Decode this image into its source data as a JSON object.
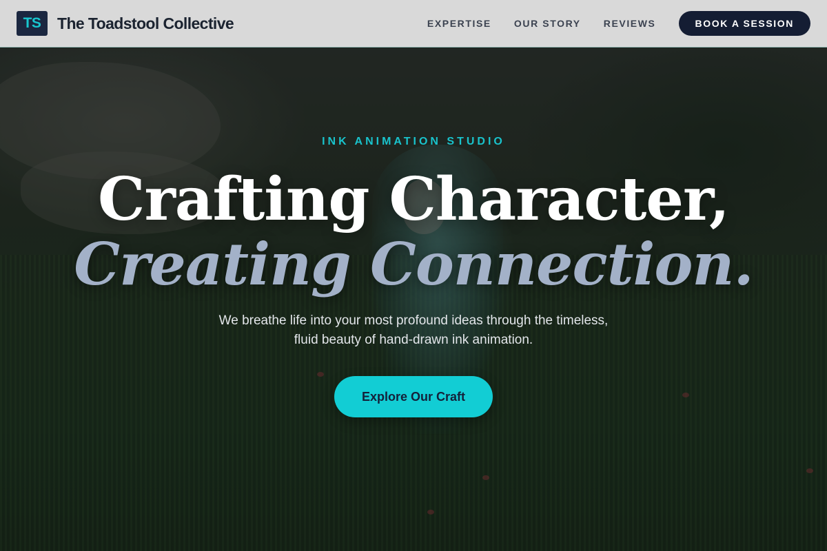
{
  "header": {
    "logo_initials": "TS",
    "brand_name": "The Toadstool Collective",
    "nav": [
      {
        "label": "EXPERTISE"
      },
      {
        "label": "OUR STORY"
      },
      {
        "label": "REVIEWS"
      }
    ],
    "cta_label": "BOOK A SESSION"
  },
  "hero": {
    "eyebrow": "INK ANIMATION STUDIO",
    "headline_line1": "Crafting Character,",
    "headline_line2": "Creating Connection.",
    "subtext_line1": "We breathe life into your most profound ideas through the timeless,",
    "subtext_line2": "fluid beauty of hand-drawn ink animation.",
    "cta_label": "Explore Our Craft"
  },
  "colors": {
    "accent": "#12cdd4",
    "navy": "#141d33",
    "header_bg": "#d9d9d9",
    "headline_secondary": "#a3b1c8"
  }
}
